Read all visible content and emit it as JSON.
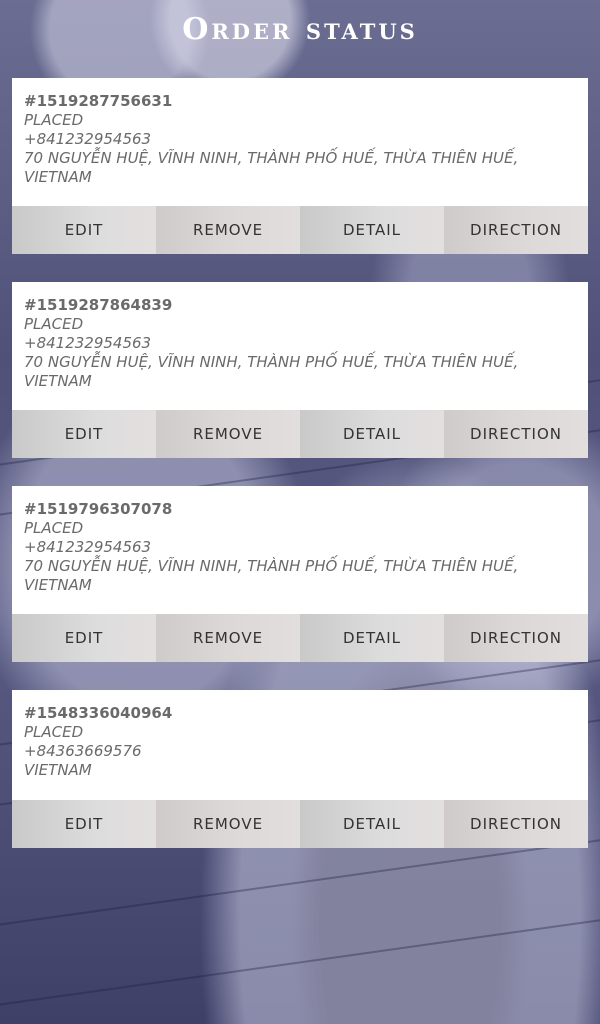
{
  "header": {
    "title": "Order status"
  },
  "orders": [
    {
      "id": "#1519287756631",
      "status": "PLACED",
      "phone": "+841232954563",
      "address": "70 NGUYỄN HUỆ, VĨNH NINH, THÀNH PHỐ HUẾ, THỪA THIÊN HUẾ, VIETNAM",
      "actions": {
        "edit": "EDIT",
        "remove": "REMOVE",
        "detail": "DETAIL",
        "direction": "DIRECTION"
      }
    },
    {
      "id": "#1519287864839",
      "status": "PLACED",
      "phone": "+841232954563",
      "address": "70 NGUYỄN HUỆ, VĨNH NINH, THÀNH PHỐ HUẾ, THỪA THIÊN HUẾ, VIETNAM",
      "actions": {
        "edit": "EDIT",
        "remove": "REMOVE",
        "detail": "DETAIL",
        "direction": "DIRECTION"
      }
    },
    {
      "id": "#1519796307078",
      "status": "PLACED",
      "phone": "+841232954563",
      "address": "70 NGUYỄN HUỆ, VĨNH NINH, THÀNH PHỐ HUẾ, THỪA THIÊN HUẾ, VIETNAM",
      "actions": {
        "edit": "EDIT",
        "remove": "REMOVE",
        "detail": "DETAIL",
        "direction": "DIRECTION"
      }
    },
    {
      "id": "#1548336040964",
      "status": "PLACED",
      "phone": "+84363669576",
      "address": "VIETNAM",
      "actions": {
        "edit": "EDIT",
        "remove": "REMOVE",
        "detail": "DETAIL",
        "direction": "DIRECTION"
      }
    }
  ]
}
